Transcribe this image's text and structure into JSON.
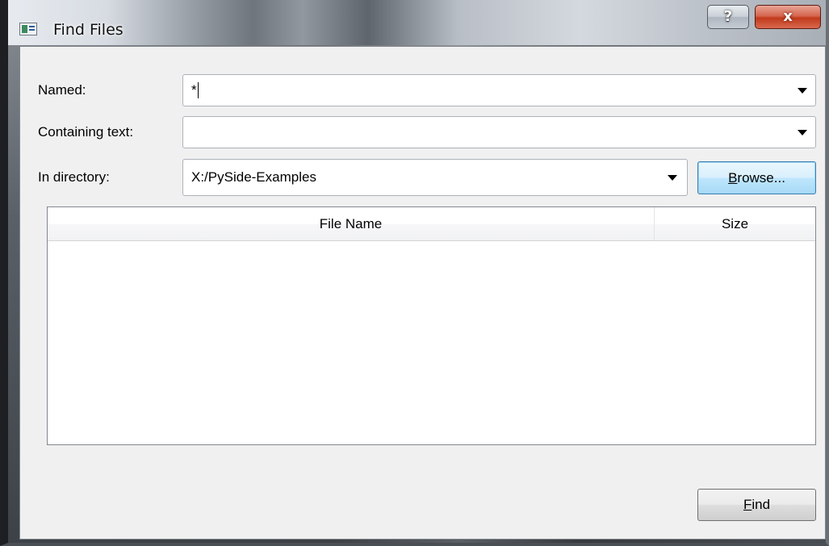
{
  "window": {
    "title": "Find Files",
    "help_label": "?",
    "close_label": "x"
  },
  "form": {
    "named_label": "Named:",
    "named_value": "*",
    "containing_label": "Containing text:",
    "containing_value": "",
    "directory_label": "In directory:",
    "directory_value": "X:/PySide-Examples",
    "browse_mnemonic": "B",
    "browse_rest": "rowse..."
  },
  "table": {
    "columns": [
      "File Name",
      "Size"
    ],
    "rows": []
  },
  "actions": {
    "find_mnemonic": "F",
    "find_rest": "ind"
  },
  "colors": {
    "client_bg": "#f0f0f0",
    "default_button_border": "#3c7fb1",
    "close_button": "#c1391b"
  },
  "icons": {
    "app": "window-app-icon",
    "dropdown": "chevron-down-icon"
  }
}
